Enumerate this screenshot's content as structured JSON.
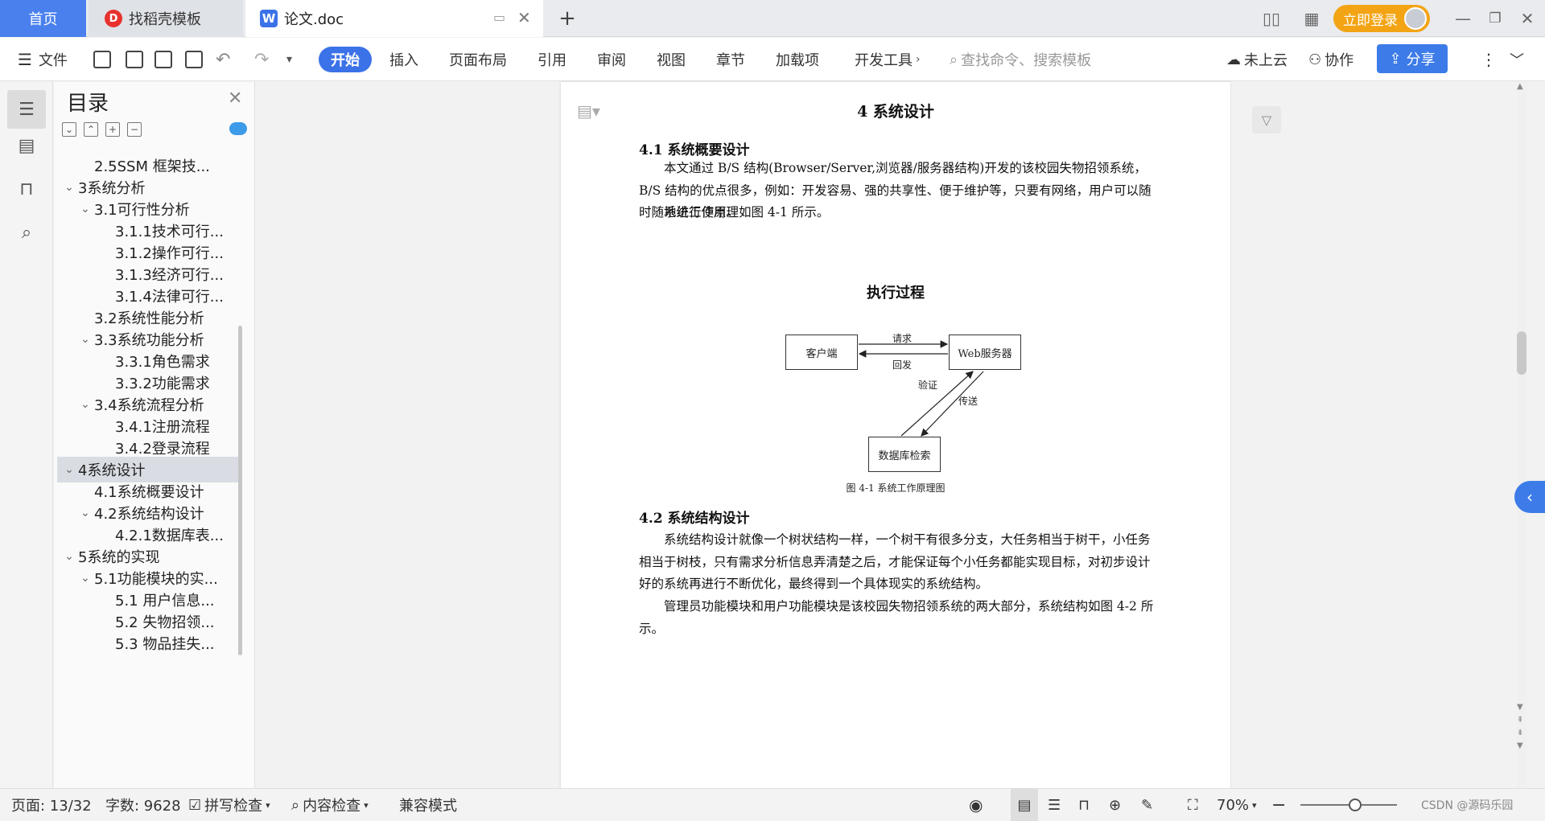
{
  "titlebar": {
    "home_tab": "首页",
    "template_tab": "找稻壳模板",
    "doc_tab": "论文.doc",
    "new_tab": "+",
    "login": "立即登录"
  },
  "toolbar": {
    "file": "文件",
    "tabs": [
      "开始",
      "插入",
      "页面布局",
      "引用",
      "审阅",
      "视图",
      "章节",
      "加载项",
      "开发工具"
    ],
    "search_placeholder": "查找命令、搜索模板",
    "cloud": "未上云",
    "collab": "协作",
    "share": "分享"
  },
  "toc": {
    "title": "目录",
    "items": [
      {
        "label": "2.5SSM 框架技...",
        "level": 1,
        "expand": ""
      },
      {
        "label": "3系统分析",
        "level": 0,
        "expand": "v"
      },
      {
        "label": "3.1可行性分析",
        "level": 1,
        "expand": "v"
      },
      {
        "label": "3.1.1技术可行...",
        "level": 2,
        "expand": ""
      },
      {
        "label": "3.1.2操作可行...",
        "level": 2,
        "expand": ""
      },
      {
        "label": "3.1.3经济可行...",
        "level": 2,
        "expand": ""
      },
      {
        "label": "3.1.4法律可行...",
        "level": 2,
        "expand": ""
      },
      {
        "label": "3.2系统性能分析",
        "level": 1,
        "expand": ""
      },
      {
        "label": "3.3系统功能分析",
        "level": 1,
        "expand": "v"
      },
      {
        "label": "3.3.1角色需求",
        "level": 2,
        "expand": ""
      },
      {
        "label": "3.3.2功能需求",
        "level": 2,
        "expand": ""
      },
      {
        "label": "3.4系统流程分析",
        "level": 1,
        "expand": "v"
      },
      {
        "label": "3.4.1注册流程",
        "level": 2,
        "expand": ""
      },
      {
        "label": "3.4.2登录流程",
        "level": 2,
        "expand": ""
      },
      {
        "label": "4系统设计",
        "level": 0,
        "expand": "v",
        "selected": true
      },
      {
        "label": "4.1系统概要设计",
        "level": 1,
        "expand": ""
      },
      {
        "label": "4.2系统结构设计",
        "level": 1,
        "expand": "v"
      },
      {
        "label": "4.2.1数据库表...",
        "level": 2,
        "expand": ""
      },
      {
        "label": "5系统的实现",
        "level": 0,
        "expand": "v"
      },
      {
        "label": "5.1功能模块的实...",
        "level": 1,
        "expand": "v"
      },
      {
        "label": "5.1 用户信息...",
        "level": 2,
        "expand": ""
      },
      {
        "label": "5.2  失物招领...",
        "level": 2,
        "expand": ""
      },
      {
        "label": "5.3 物品挂失...",
        "level": 2,
        "expand": ""
      }
    ]
  },
  "document": {
    "chapter_title": "4  系统设计",
    "section_1_title": "4.1  系统概要设计",
    "para_1": "本文通过 B/S 结构(Browser/Server,浏览器/服务器结构)开发的该校园失物招领系统，B/S 结构的优点很多，例如：开发容易、强的共享性、便于维护等，只要有网络，用户可以随时随地进行使用。",
    "para_2": "系统工作原理如图 4-1 所示。",
    "diagram": {
      "title": "执行过程",
      "client": "客户端",
      "server": "Web服务器",
      "db": "数据库检索",
      "req": "请求",
      "resp": "回发",
      "verify": "验证",
      "transfer": "传送",
      "caption": "图 4-1  系统工作原理图"
    },
    "section_2_title": "4.2  系统结构设计",
    "para_3": "系统结构设计就像一个树状结构一样，一个树干有很多分支，大任务相当于树干，小任务相当于树枝，只有需求分析信息弄清楚之后，才能保证每个小任务都能实现目标，对初步设计好的系统再进行不断优化，最终得到一个具体现实的系统结构。",
    "para_4": "管理员功能模块和用户功能模块是该校园失物招领系统的两大部分，系统结构如图 4-2 所示。"
  },
  "status": {
    "page": "页面: 13/32",
    "words": "字数: 9628",
    "spell": "拼写检查",
    "content": "内容检查",
    "compat": "兼容模式",
    "zoom": "70%",
    "watermark": "CSDN @源码乐园"
  },
  "colors": {
    "accent": "#3c72e8",
    "login": "#f3a415"
  }
}
